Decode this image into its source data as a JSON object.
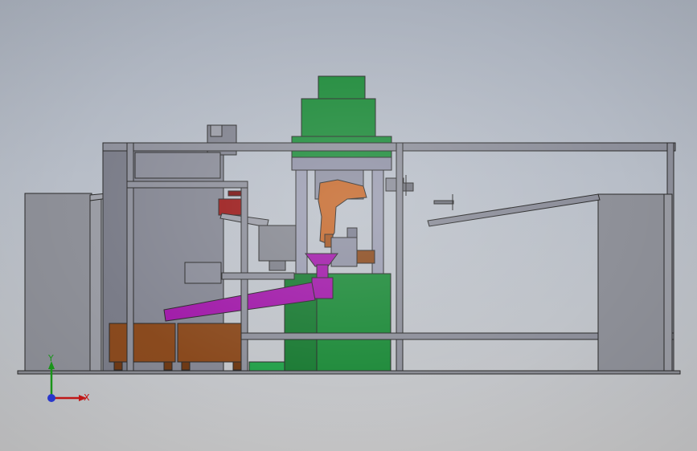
{
  "viewport": {
    "background_top": "#aab1bd",
    "background_bottom": "#c7c7c8"
  },
  "colors": {
    "frame_steel": "#8d8f9a",
    "housing_green": "#1e8a3a",
    "pipe_magenta": "#a01aa8",
    "pallet_brown": "#8a4a1e",
    "robot_orange": "#c4672a",
    "edge_line": "#2a2a2a"
  },
  "triad": {
    "x_label": "X",
    "y_label": "Y",
    "icons": [
      "x-axis-arrow-icon",
      "y-axis-arrow-icon",
      "z-axis-dot-icon"
    ]
  }
}
